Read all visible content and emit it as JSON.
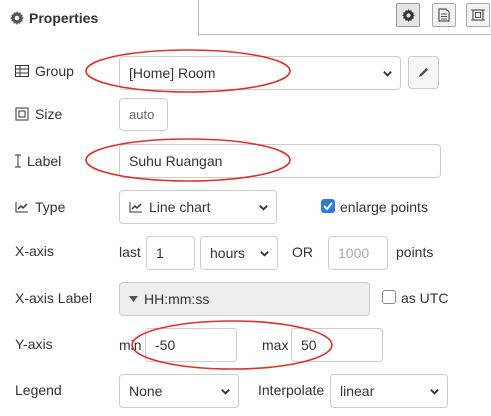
{
  "header": {
    "tab_label": "Properties",
    "tab_icon": "gear-icon",
    "tools": [
      "settings-gear-icon",
      "description-doc-icon",
      "appearance-frame-icon"
    ]
  },
  "form": {
    "group": {
      "label": "Group",
      "value": "[Home] Room"
    },
    "size": {
      "label": "Size",
      "value": "auto"
    },
    "label": {
      "label": "Label",
      "value": "Suhu Ruangan"
    },
    "type": {
      "label": "Type",
      "value": "Line chart",
      "enlarge_label": "enlarge points",
      "enlarge_checked": true
    },
    "xaxis": {
      "label": "X-axis",
      "last_label": "last",
      "last_value": "1",
      "unit_value": "hours",
      "or_label": "OR",
      "points_placeholder": "1000",
      "points_label": "points"
    },
    "xaxis_label": {
      "label": "X-axis Label",
      "value": "HH:mm:ss",
      "utc_label": "as UTC",
      "utc_checked": false
    },
    "yaxis": {
      "label": "Y-axis",
      "min_label": "min",
      "min_value": "-50",
      "max_label": "max",
      "max_value": "50"
    },
    "legend": {
      "label": "Legend",
      "value": "None",
      "interpolate_label": "Interpolate",
      "interpolate_value": "linear"
    }
  },
  "annotation_color": "#e0302a",
  "checkbox_color": "#2a7ae2"
}
